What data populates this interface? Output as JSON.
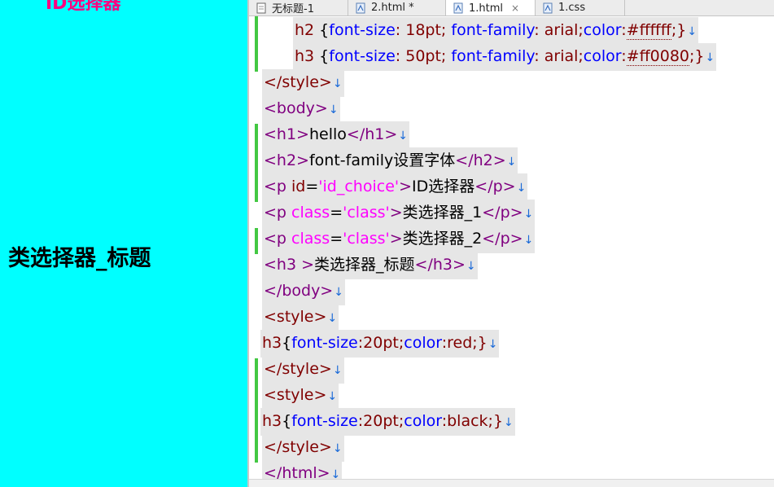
{
  "preview": {
    "top_text": "ID选择器",
    "h3_text": "类选择器_标题"
  },
  "tabs": [
    {
      "label": "无标题-1",
      "active": false,
      "closable": false
    },
    {
      "label": "2.html *",
      "active": false,
      "closable": false
    },
    {
      "label": "1.html",
      "active": true,
      "closable": true,
      "close_glyph": "×"
    },
    {
      "label": "1.css",
      "active": false,
      "closable": false
    }
  ],
  "colors": {
    "preview_bg": "#00ffff",
    "change_bar": "#43c843",
    "tag": "#800080",
    "selector": "#800000",
    "property": "#0000ff",
    "string": "#ff00ff"
  },
  "code": {
    "l1": {
      "sel": "h2",
      "open": " {",
      "p1": "font-size",
      "v1": ": 18pt; ",
      "p2": "font-family",
      "v2": ": arial;",
      "p3": "color",
      "v3a": ":",
      "v3b": "#ffffff",
      "close": ";}"
    },
    "l2": {
      "sel": "h3",
      "open": " {",
      "p1": "font-size",
      "v1": ": 50pt; ",
      "p2": "font-family",
      "v2": ": arial;",
      "p3": "color",
      "v3a": ":",
      "v3b": "#ff0080",
      "close": ";}"
    },
    "l3": {
      "text": "</style>"
    },
    "l4": {
      "text": "<body>"
    },
    "l5": {
      "open": "<h1>",
      "inner": "hello",
      "close": "</h1>"
    },
    "l6": {
      "open": "<h2>",
      "inner": "font-family设置字体",
      "close": "</h2>"
    },
    "l7": {
      "open": "<p ",
      "attr": "id",
      "eq": "=",
      "str": "'id_choice'",
      "gt": ">",
      "inner": "ID选择器",
      "close": "</p>"
    },
    "l8": {
      "open": "<p ",
      "attr": "class",
      "eq": "=",
      "str": "'class'",
      "gt": ">",
      "inner": "类选择器_1",
      "close": "</p>"
    },
    "l9": {
      "open": "<p ",
      "attr": "class",
      "eq": "=",
      "str": "'class'",
      "gt": ">",
      "inner": "类选择器_2",
      "close": "</p>"
    },
    "l10": {
      "open": "<h3 >",
      "inner": "类选择器_标题",
      "close": "</h3>"
    },
    "l11": {
      "text": "</body>"
    },
    "l12": {
      "text": "<style>"
    },
    "l13": {
      "sel": "h3",
      "b1": "{",
      "p1": "font-size",
      "v1": ":20pt;",
      "p2": "color",
      "v2": ":red;}"
    },
    "l14": {
      "text": "</style>"
    },
    "l15": {
      "text": "<style>"
    },
    "l16": {
      "sel": "h3",
      "b1": "{",
      "p1": "font-size",
      "v1": ":20pt;",
      "p2": "color",
      "v2": ":black;}"
    },
    "l17": {
      "text": "</style>"
    },
    "l18": {
      "text": "</html>"
    },
    "eol": "↓"
  }
}
